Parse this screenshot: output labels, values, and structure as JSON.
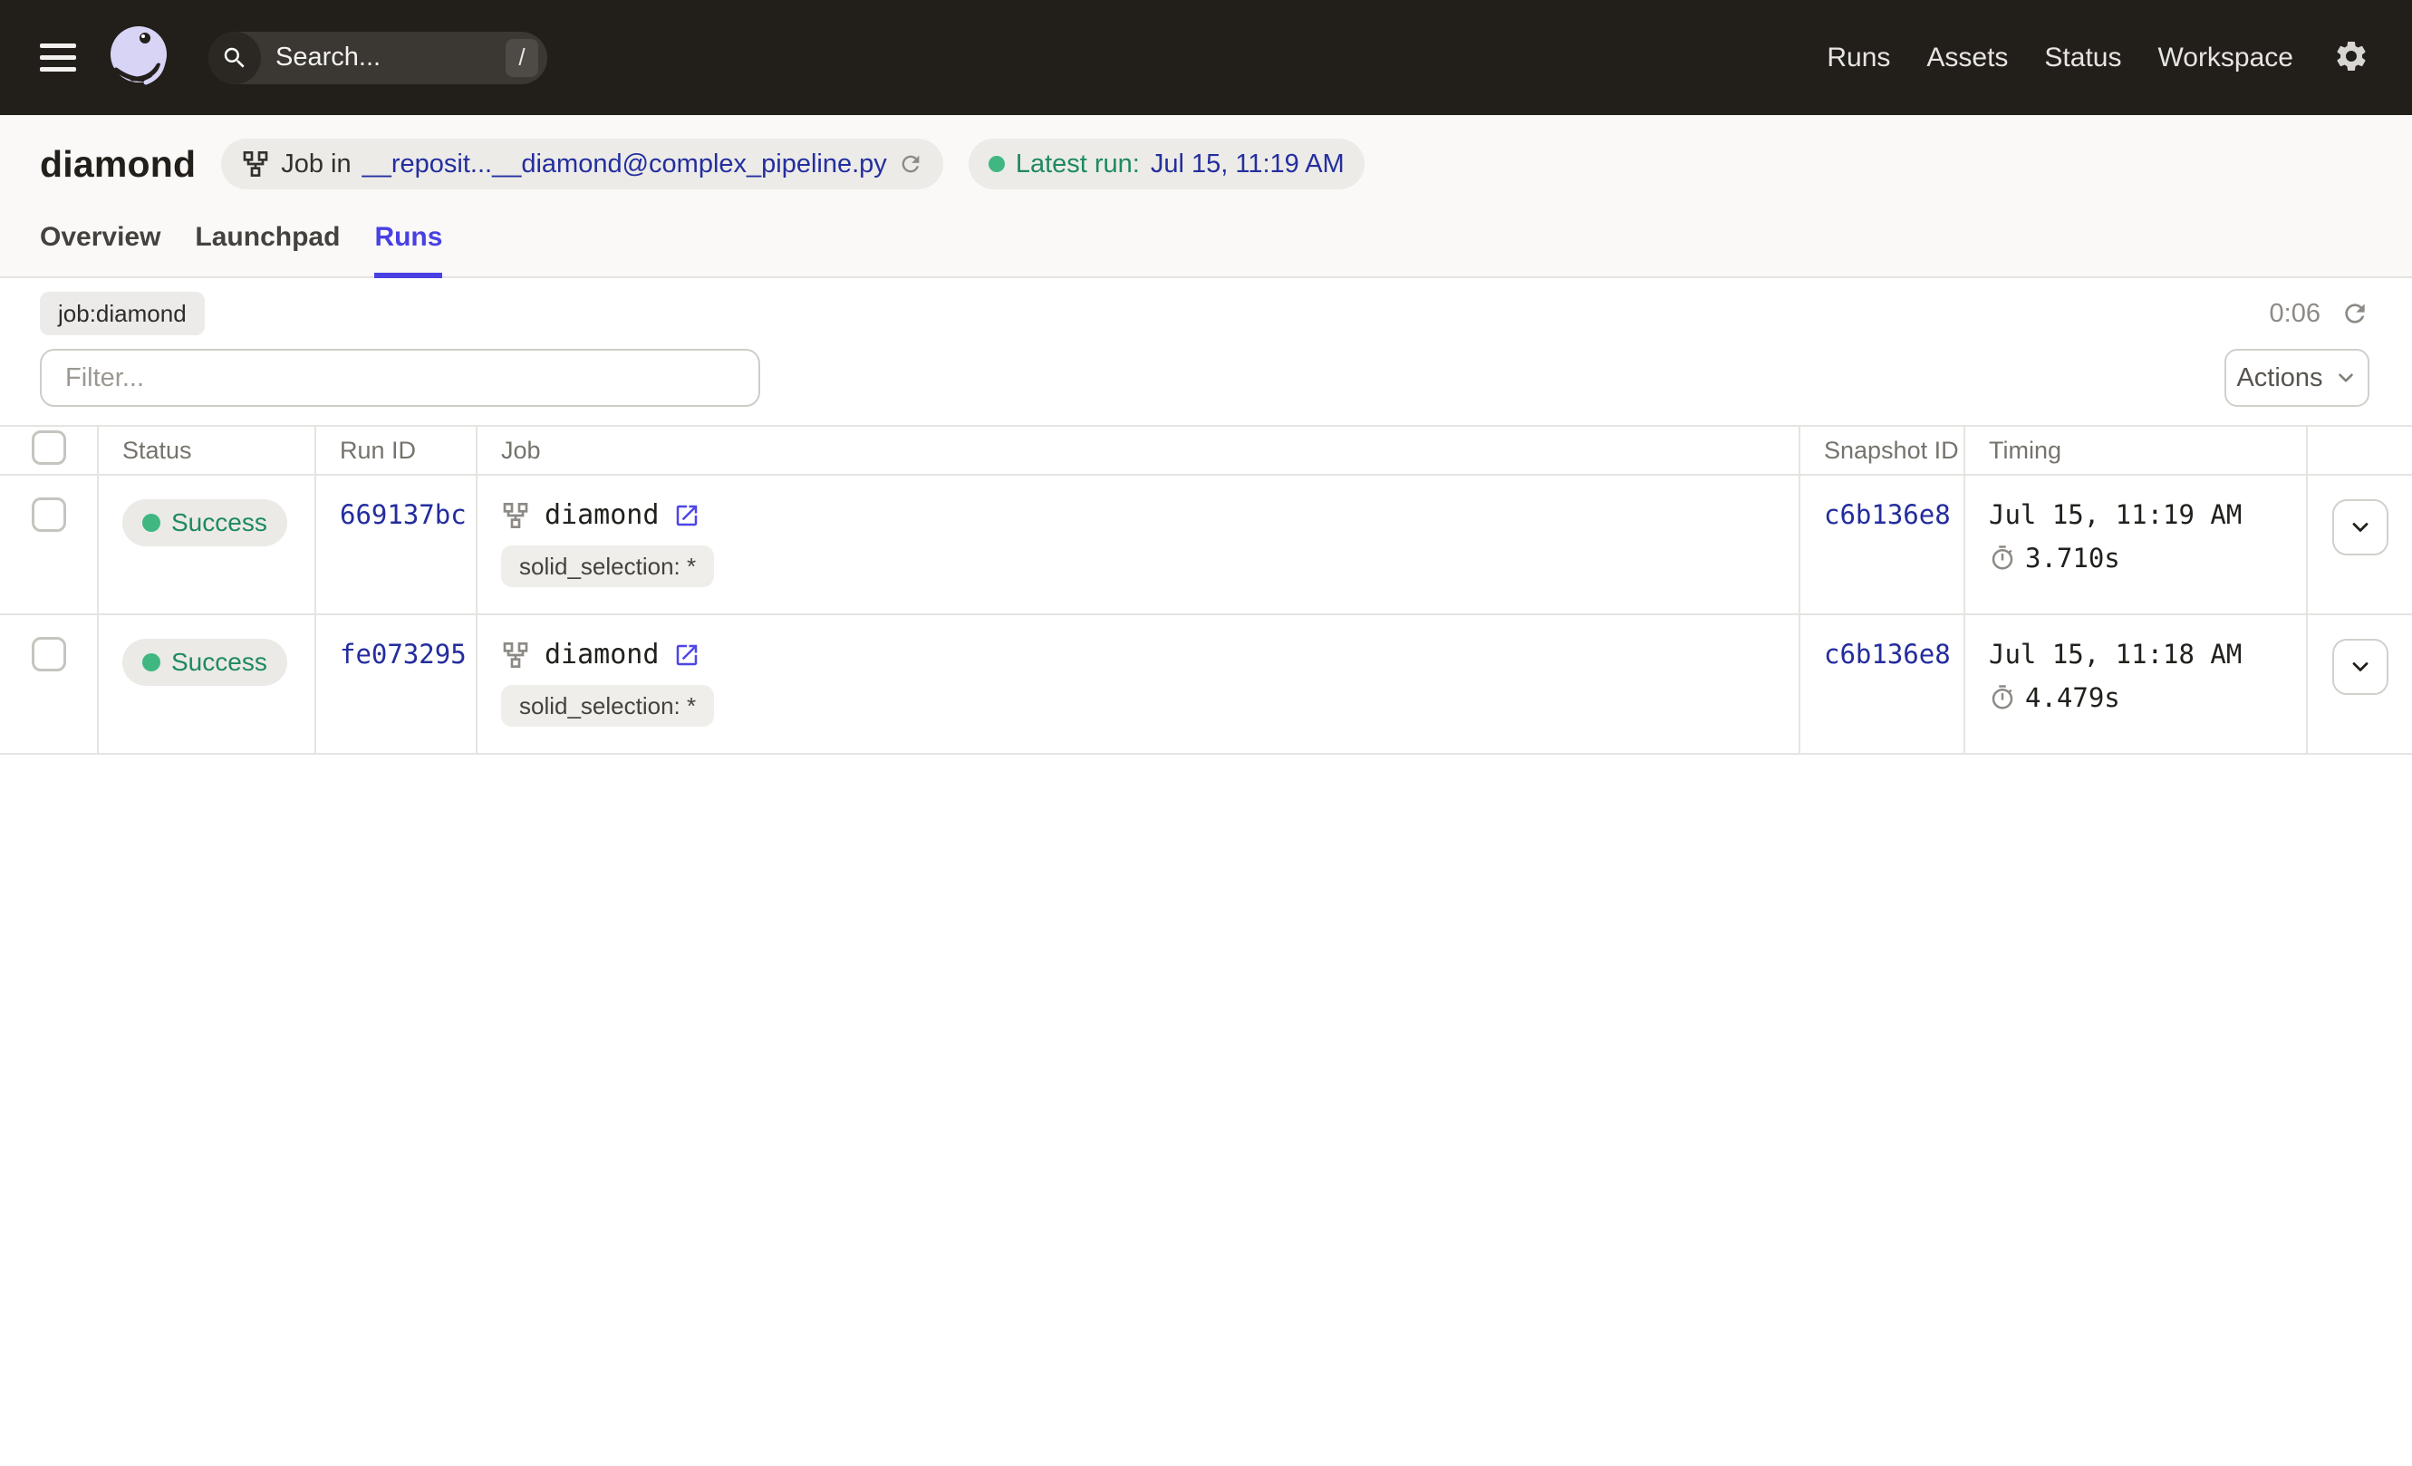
{
  "topbar": {
    "search": {
      "placeholder": "Search...",
      "shortcut_key": "/"
    },
    "nav_items": [
      "Runs",
      "Assets",
      "Status",
      "Workspace"
    ]
  },
  "header": {
    "title": "diamond",
    "job_badge": {
      "prefix": "Job in",
      "target": "__reposit...__diamond@complex_pipeline.py"
    },
    "latest_run": {
      "label": "Latest run:",
      "value": "Jul 15, 11:19 AM"
    },
    "tabs": {
      "overview": "Overview",
      "launchpad": "Launchpad",
      "runs": "Runs"
    }
  },
  "toolbar": {
    "filter_token": "job:diamond",
    "refresh_countdown": "0:06",
    "filter_placeholder": "Filter...",
    "actions_label": "Actions"
  },
  "table": {
    "columns": [
      "Status",
      "Run ID",
      "Job",
      "Snapshot ID",
      "Timing"
    ],
    "rows": [
      {
        "status": "Success",
        "run_id": "669137bc",
        "job_name": "diamond",
        "tag": "solid_selection: *",
        "snapshot_id": "c6b136e8",
        "timestamp": "Jul 15, 11:19 AM",
        "duration": "3.710s"
      },
      {
        "status": "Success",
        "run_id": "fe073295",
        "job_name": "diamond",
        "tag": "solid_selection: *",
        "snapshot_id": "c6b136e8",
        "timestamp": "Jul 15, 11:18 AM",
        "duration": "4.479s"
      }
    ]
  },
  "colors": {
    "topbar_bg": "#221E1A",
    "accent_indigo": "#4940E4",
    "link_navy": "#232D9D",
    "success_green": "#1E8A5E",
    "success_dot": "#40B781",
    "external_link_purple": "#4F46E5",
    "logo_lavender": "#D8D4F6"
  }
}
